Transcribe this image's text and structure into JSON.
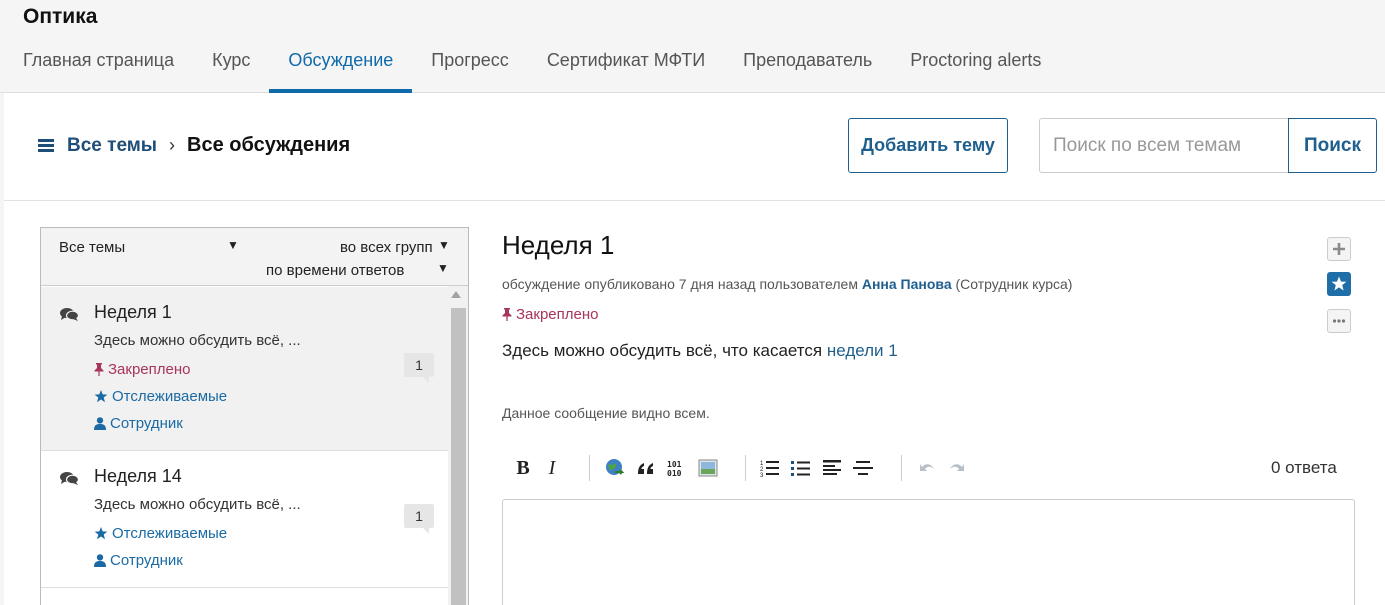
{
  "course": {
    "title": "Оптика"
  },
  "tabs": [
    {
      "label": "Главная страница"
    },
    {
      "label": "Курс"
    },
    {
      "label": "Обсуждение",
      "active": true
    },
    {
      "label": "Прогресс"
    },
    {
      "label": "Сертификат МФТИ"
    },
    {
      "label": "Преподаватель"
    },
    {
      "label": "Proctoring alerts"
    }
  ],
  "toolbar": {
    "all_topics": "Все темы",
    "separator": "›",
    "current": "Все обсуждения",
    "add_topic": "Добавить тему",
    "search_placeholder": "Поиск по всем темам",
    "search_button": "Поиск"
  },
  "filters": {
    "topic": "Все темы",
    "group": "во всех группах",
    "sort": "по времени ответов"
  },
  "threads": [
    {
      "title": "Неделя 1",
      "preview": "Здесь можно обсудить всё, ...",
      "pinned": "Закреплено",
      "followed": "Отслеживаемые",
      "staff": "Сотрудник",
      "count": "1"
    },
    {
      "title": "Неделя 14",
      "preview": "Здесь можно обсудить всё, ...",
      "followed": "Отслеживаемые",
      "staff": "Сотрудник",
      "count": "1"
    }
  ],
  "post": {
    "title": "Неделя 1",
    "meta_prefix": "обсуждение опубликовано 7 дня назад пользователем",
    "author": "Анна Панова",
    "role": "(Сотрудник курса)",
    "pinned": "Закреплено",
    "body_text": "Здесь можно обсудить всё, что касается",
    "body_link": "недели 1",
    "visibility": "Данное сообщение видно всем.",
    "responses": "0 ответа"
  },
  "colors": {
    "accent": "#0e6aa8",
    "pinned": "#a8355a",
    "link": "#1b6aa3"
  }
}
